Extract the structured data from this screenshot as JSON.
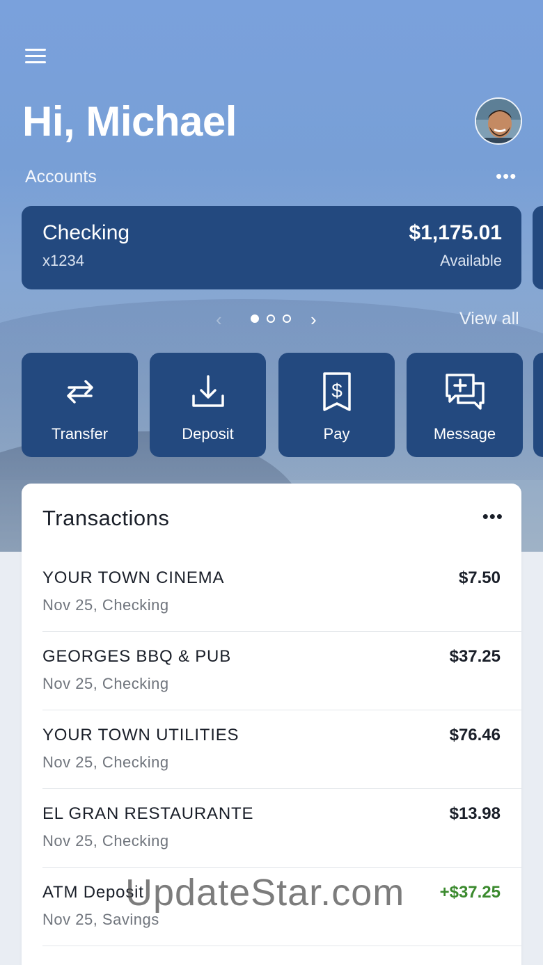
{
  "header": {
    "greeting": "Hi, Michael",
    "accounts_label": "Accounts",
    "more_icon_text": "•••"
  },
  "account": {
    "name": "Checking",
    "number": "x1234",
    "balance": "$1,175.01",
    "balance_label": "Available"
  },
  "pager": {
    "prev_glyph": "‹",
    "next_glyph": "›",
    "view_all": "View all",
    "pages": 3,
    "current_page": 1
  },
  "actions": [
    {
      "label": "Transfer",
      "icon": "transfer-icon"
    },
    {
      "label": "Deposit",
      "icon": "deposit-icon"
    },
    {
      "label": "Pay",
      "icon": "pay-bill-icon"
    },
    {
      "label": "Message",
      "icon": "message-icon"
    }
  ],
  "transactions": {
    "title": "Transactions",
    "more_icon_text": "•••",
    "items": [
      {
        "merchant": "YOUR TOWN CINEMA",
        "meta": "Nov 25, Checking",
        "amount": "$7.50"
      },
      {
        "merchant": "GEORGES BBQ & PUB",
        "meta": "Nov 25, Checking",
        "amount": "$37.25"
      },
      {
        "merchant": "YOUR TOWN UTILITIES",
        "meta": "Nov 25, Checking",
        "amount": "$76.46"
      },
      {
        "merchant": "EL GRAN RESTAURANTE",
        "meta": "Nov 25, Checking",
        "amount": "$13.98"
      },
      {
        "merchant": "ATM Deposit",
        "meta": "Nov 25, Savings",
        "amount": "+$37.25"
      }
    ]
  },
  "watermark": "UpdateStar.com",
  "colors": {
    "card": "#23497f",
    "credit": "#3b8a2e",
    "hero_sky": "#7aa1dc"
  }
}
